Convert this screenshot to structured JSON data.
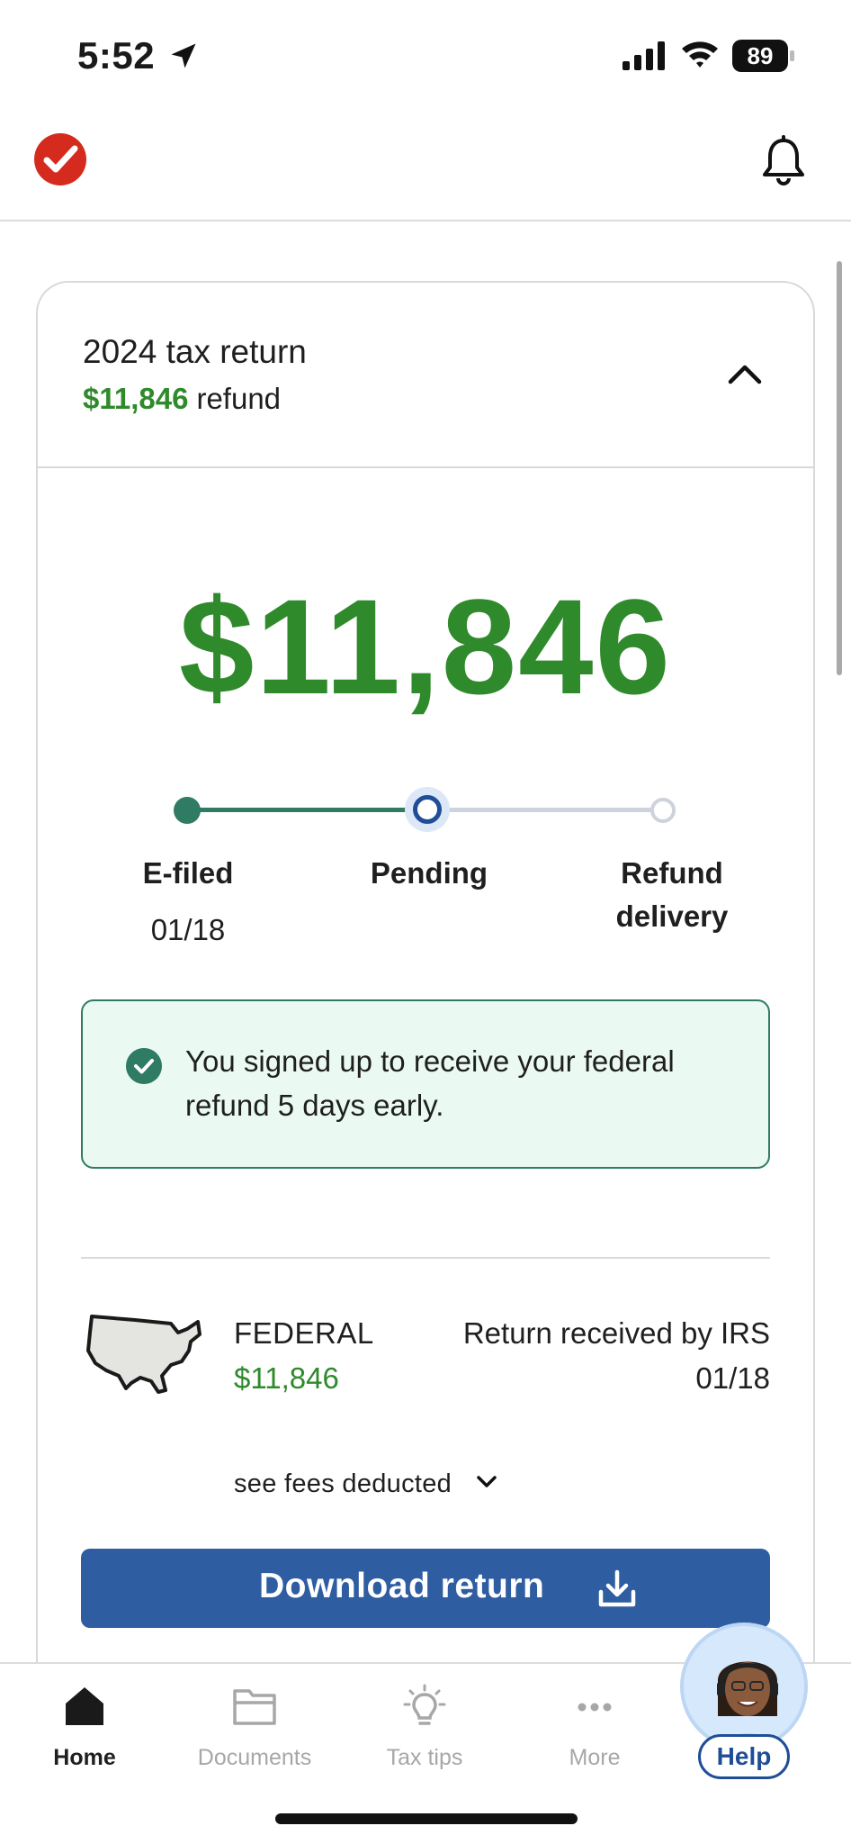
{
  "status_bar": {
    "time": "5:52",
    "battery": "89"
  },
  "header": {
    "logo": "turbotax-check-icon",
    "notification_icon": "bell-icon"
  },
  "return_card": {
    "title": "2024 tax return",
    "refund_amount": "$11,846",
    "refund_word": "refund",
    "big_amount": "$11,846",
    "progress": {
      "steps": [
        {
          "label": "E-filed",
          "date": "01/18",
          "state": "done"
        },
        {
          "label": "Pending",
          "date": "",
          "state": "current"
        },
        {
          "label": "Refund delivery",
          "date": "",
          "state": "todo"
        }
      ]
    },
    "notice": "You signed up to receive your federal refund 5 days early.",
    "federal": {
      "label": "FEDERAL",
      "amount": "$11,846",
      "status": "Return received by IRS",
      "date": "01/18"
    },
    "fees_link": "see fees deducted",
    "download_label": "Download return"
  },
  "bottom_nav": {
    "items": [
      {
        "label": "Home",
        "icon": "home-icon",
        "active": true
      },
      {
        "label": "Documents",
        "icon": "folder-icon",
        "active": false
      },
      {
        "label": "Tax tips",
        "icon": "lightbulb-icon",
        "active": false
      },
      {
        "label": "More",
        "icon": "more-dots-icon",
        "active": false
      }
    ],
    "help_label": "Help"
  },
  "colors": {
    "green": "#2f8a2c",
    "progress_green": "#2f7b63",
    "blue": "#2f5da1",
    "brand_red": "#d52b1e"
  }
}
